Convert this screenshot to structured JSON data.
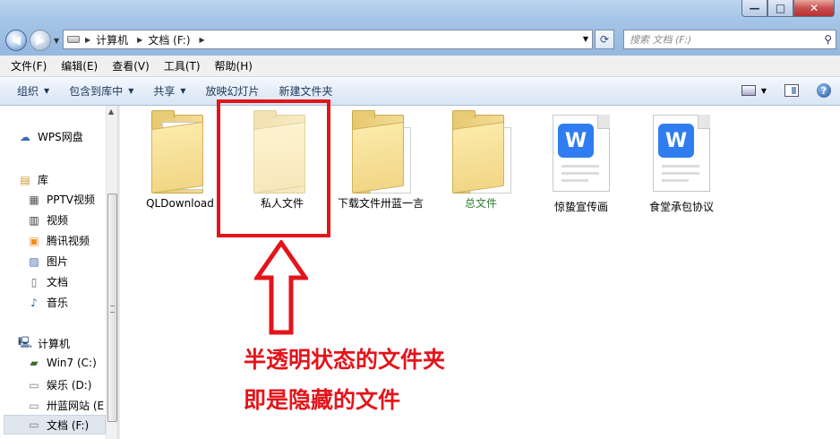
{
  "window": {
    "controls": {
      "minimize": "—",
      "maximize": "□",
      "close": "✕"
    }
  },
  "address": {
    "segments": [
      "计算机",
      "文档 (F:)"
    ],
    "search_placeholder": "搜索 文档 (F:)"
  },
  "menubar": [
    "文件(F)",
    "编辑(E)",
    "查看(V)",
    "工具(T)",
    "帮助(H)"
  ],
  "toolbar": {
    "organize": "组织",
    "include_in_library": "包含到库中",
    "share": "共享",
    "slideshow": "放映幻灯片",
    "new_folder": "新建文件夹"
  },
  "sidebar": {
    "wps_cloud": "WPS网盘",
    "libraries": "库",
    "library_items": [
      "PPTV视频",
      "视频",
      "腾讯视频",
      "图片",
      "文档",
      "音乐"
    ],
    "computer": "计算机",
    "drives": [
      "Win7 (C:)",
      "娱乐 (D:)",
      "卅蓝网站 (E",
      "文档 (F:)"
    ]
  },
  "files": [
    {
      "name": "QLDownload",
      "type": "folder",
      "hidden": false
    },
    {
      "name": "私人文件",
      "type": "folder",
      "hidden": true
    },
    {
      "name": "下载文件卅蓝一言",
      "type": "folder",
      "hidden": false
    },
    {
      "name": "总文件",
      "type": "folder",
      "hidden": false,
      "label_color": "#2e7a2e"
    },
    {
      "name": "惊蛰宣传画",
      "type": "wps-doc"
    },
    {
      "name": "食堂承包协议",
      "type": "wps-doc"
    }
  ],
  "annotation": {
    "line1": "半透明状态的文件夹",
    "line2": "即是隐藏的文件",
    "color": "#e4141b"
  },
  "colors": {
    "accent": "#2f7df0",
    "annotation_red": "#e4141b"
  }
}
